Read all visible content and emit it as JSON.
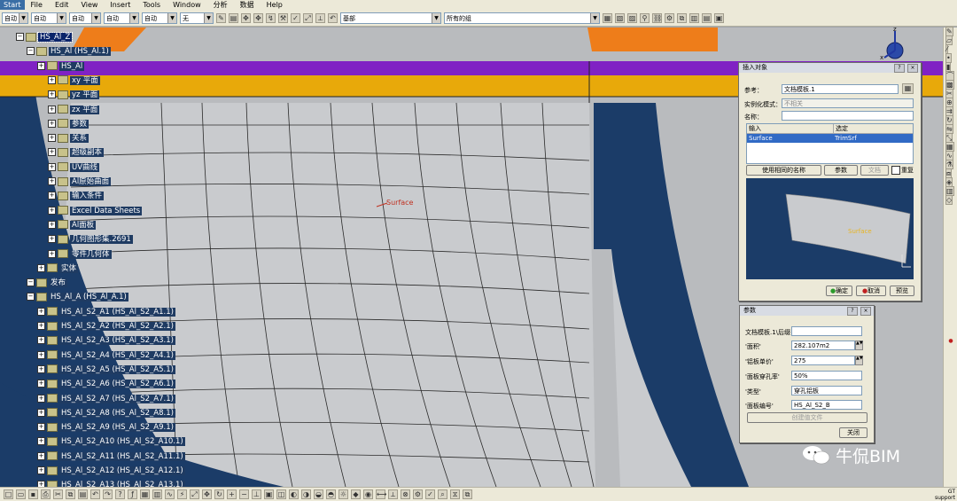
{
  "menu": [
    "Start",
    "File",
    "Edit",
    "View",
    "Insert",
    "Tools",
    "Window",
    "分析",
    "数据",
    "Help"
  ],
  "toolbar": {
    "combo1": "自动",
    "combo2": "自动",
    "combo3": "自动",
    "combo4": "自动",
    "combo5": "自动",
    "combo6": "无",
    "layer": "基部",
    "group": "所有的组"
  },
  "tree": {
    "nodes": [
      {
        "label": "HS_Al_Z",
        "level": 0,
        "selected": true
      },
      {
        "label": "HS_Al (HS_Al.1)",
        "level": 1
      },
      {
        "label": "HS_Al",
        "level": 2
      },
      {
        "label": "xy 平面",
        "level": 3
      },
      {
        "label": "yz 平面",
        "level": 3
      },
      {
        "label": "zx 平面",
        "level": 3
      },
      {
        "label": "参数",
        "level": 3
      },
      {
        "label": "关系",
        "level": 3
      },
      {
        "label": "超级副本",
        "level": 3
      },
      {
        "label": "UV曲线",
        "level": 3
      },
      {
        "label": "Al原始曲面",
        "level": 3
      },
      {
        "label": "输入条件",
        "level": 3
      },
      {
        "label": "Excel Data Sheets",
        "level": 3
      },
      {
        "label": "Al面板",
        "level": 3
      },
      {
        "label": "几何图形集.2691",
        "level": 3
      },
      {
        "label": "零件几何体",
        "level": 3
      },
      {
        "label": "实体",
        "level": 2
      },
      {
        "label": "发布",
        "level": 1
      },
      {
        "label": "HS_Al_A (HS_Al_A.1)",
        "level": 1
      },
      {
        "label": "HS_Al_S2_A1 (HS_Al_S2_A1.1)",
        "level": 2
      },
      {
        "label": "HS_Al_S2_A2 (HS_Al_S2_A2.1)",
        "level": 2
      },
      {
        "label": "HS_Al_S2_A3 (HS_Al_S2_A3.1)",
        "level": 2
      },
      {
        "label": "HS_Al_S2_A4 (HS_Al_S2_A4.1)",
        "level": 2
      },
      {
        "label": "HS_Al_S2_A5 (HS_Al_S2_A5.1)",
        "level": 2
      },
      {
        "label": "HS_Al_S2_A6 (HS_Al_S2_A6.1)",
        "level": 2
      },
      {
        "label": "HS_Al_S2_A7 (HS_Al_S2_A7.1)",
        "level": 2
      },
      {
        "label": "HS_Al_S2_A8 (HS_Al_S2_A8.1)",
        "level": 2
      },
      {
        "label": "HS_Al_S2_A9 (HS_Al_S2_A9.1)",
        "level": 2
      },
      {
        "label": "HS_Al_S2_A10 (HS_Al_S2_A10.1)",
        "level": 2
      },
      {
        "label": "HS_Al_S2_A11 (HS_Al_S2_A11.1)",
        "level": 2
      },
      {
        "label": "HS_Al_S2_A12 (HS_Al_S2_A12.1)",
        "level": 2
      },
      {
        "label": "HS_Al_S2_A13 (HS_Al_S2_A13.1)",
        "level": 2
      }
    ]
  },
  "viewport": {
    "surface_label": "Surface"
  },
  "insert_dialog": {
    "title": "插入对象",
    "ref_label": "参考：",
    "ref_value": "文档模板.1",
    "mode_label": "实例化模式：",
    "mode_value": "不相关",
    "name_label": "名称：",
    "name_value": "",
    "col_input": "输入",
    "col_selected": "选定",
    "row_input": "Surface",
    "row_selected": "TrimSrf",
    "btn_same_name": "使用相同的名称",
    "btn_params": "参数",
    "btn_docs": "文档",
    "chk_repeat": "重复",
    "preview_label": "Surface",
    "btn_ok": "确定",
    "btn_cancel": "取消",
    "btn_preview": "预览"
  },
  "params_dialog": {
    "title": "参数",
    "rows": [
      {
        "label": "文档模板.1\\后缀",
        "value": ""
      },
      {
        "label": "'面积'",
        "value": "282.107m2"
      },
      {
        "label": "'铝板单价'",
        "value": "275"
      },
      {
        "label": "'面板穿孔率'",
        "value": "50%"
      },
      {
        "label": "'类型'",
        "value": "穿孔铝板"
      },
      {
        "label": "'面板编号'",
        "value": "HS_Al_S2_B"
      }
    ],
    "btn_create": "创建值文件",
    "btn_close": "关闭"
  },
  "compass": {
    "axis_z": "z",
    "axis_x": "x"
  },
  "watermark": {
    "text": "牛侃BIM"
  },
  "status": {
    "line1": "GT",
    "line2": "support"
  },
  "colors": {
    "orange": "#ee7d1a",
    "purple": "#8022c4",
    "gold": "#e8a90a",
    "navy": "#1b3c68",
    "panel": "#c9cbce"
  }
}
